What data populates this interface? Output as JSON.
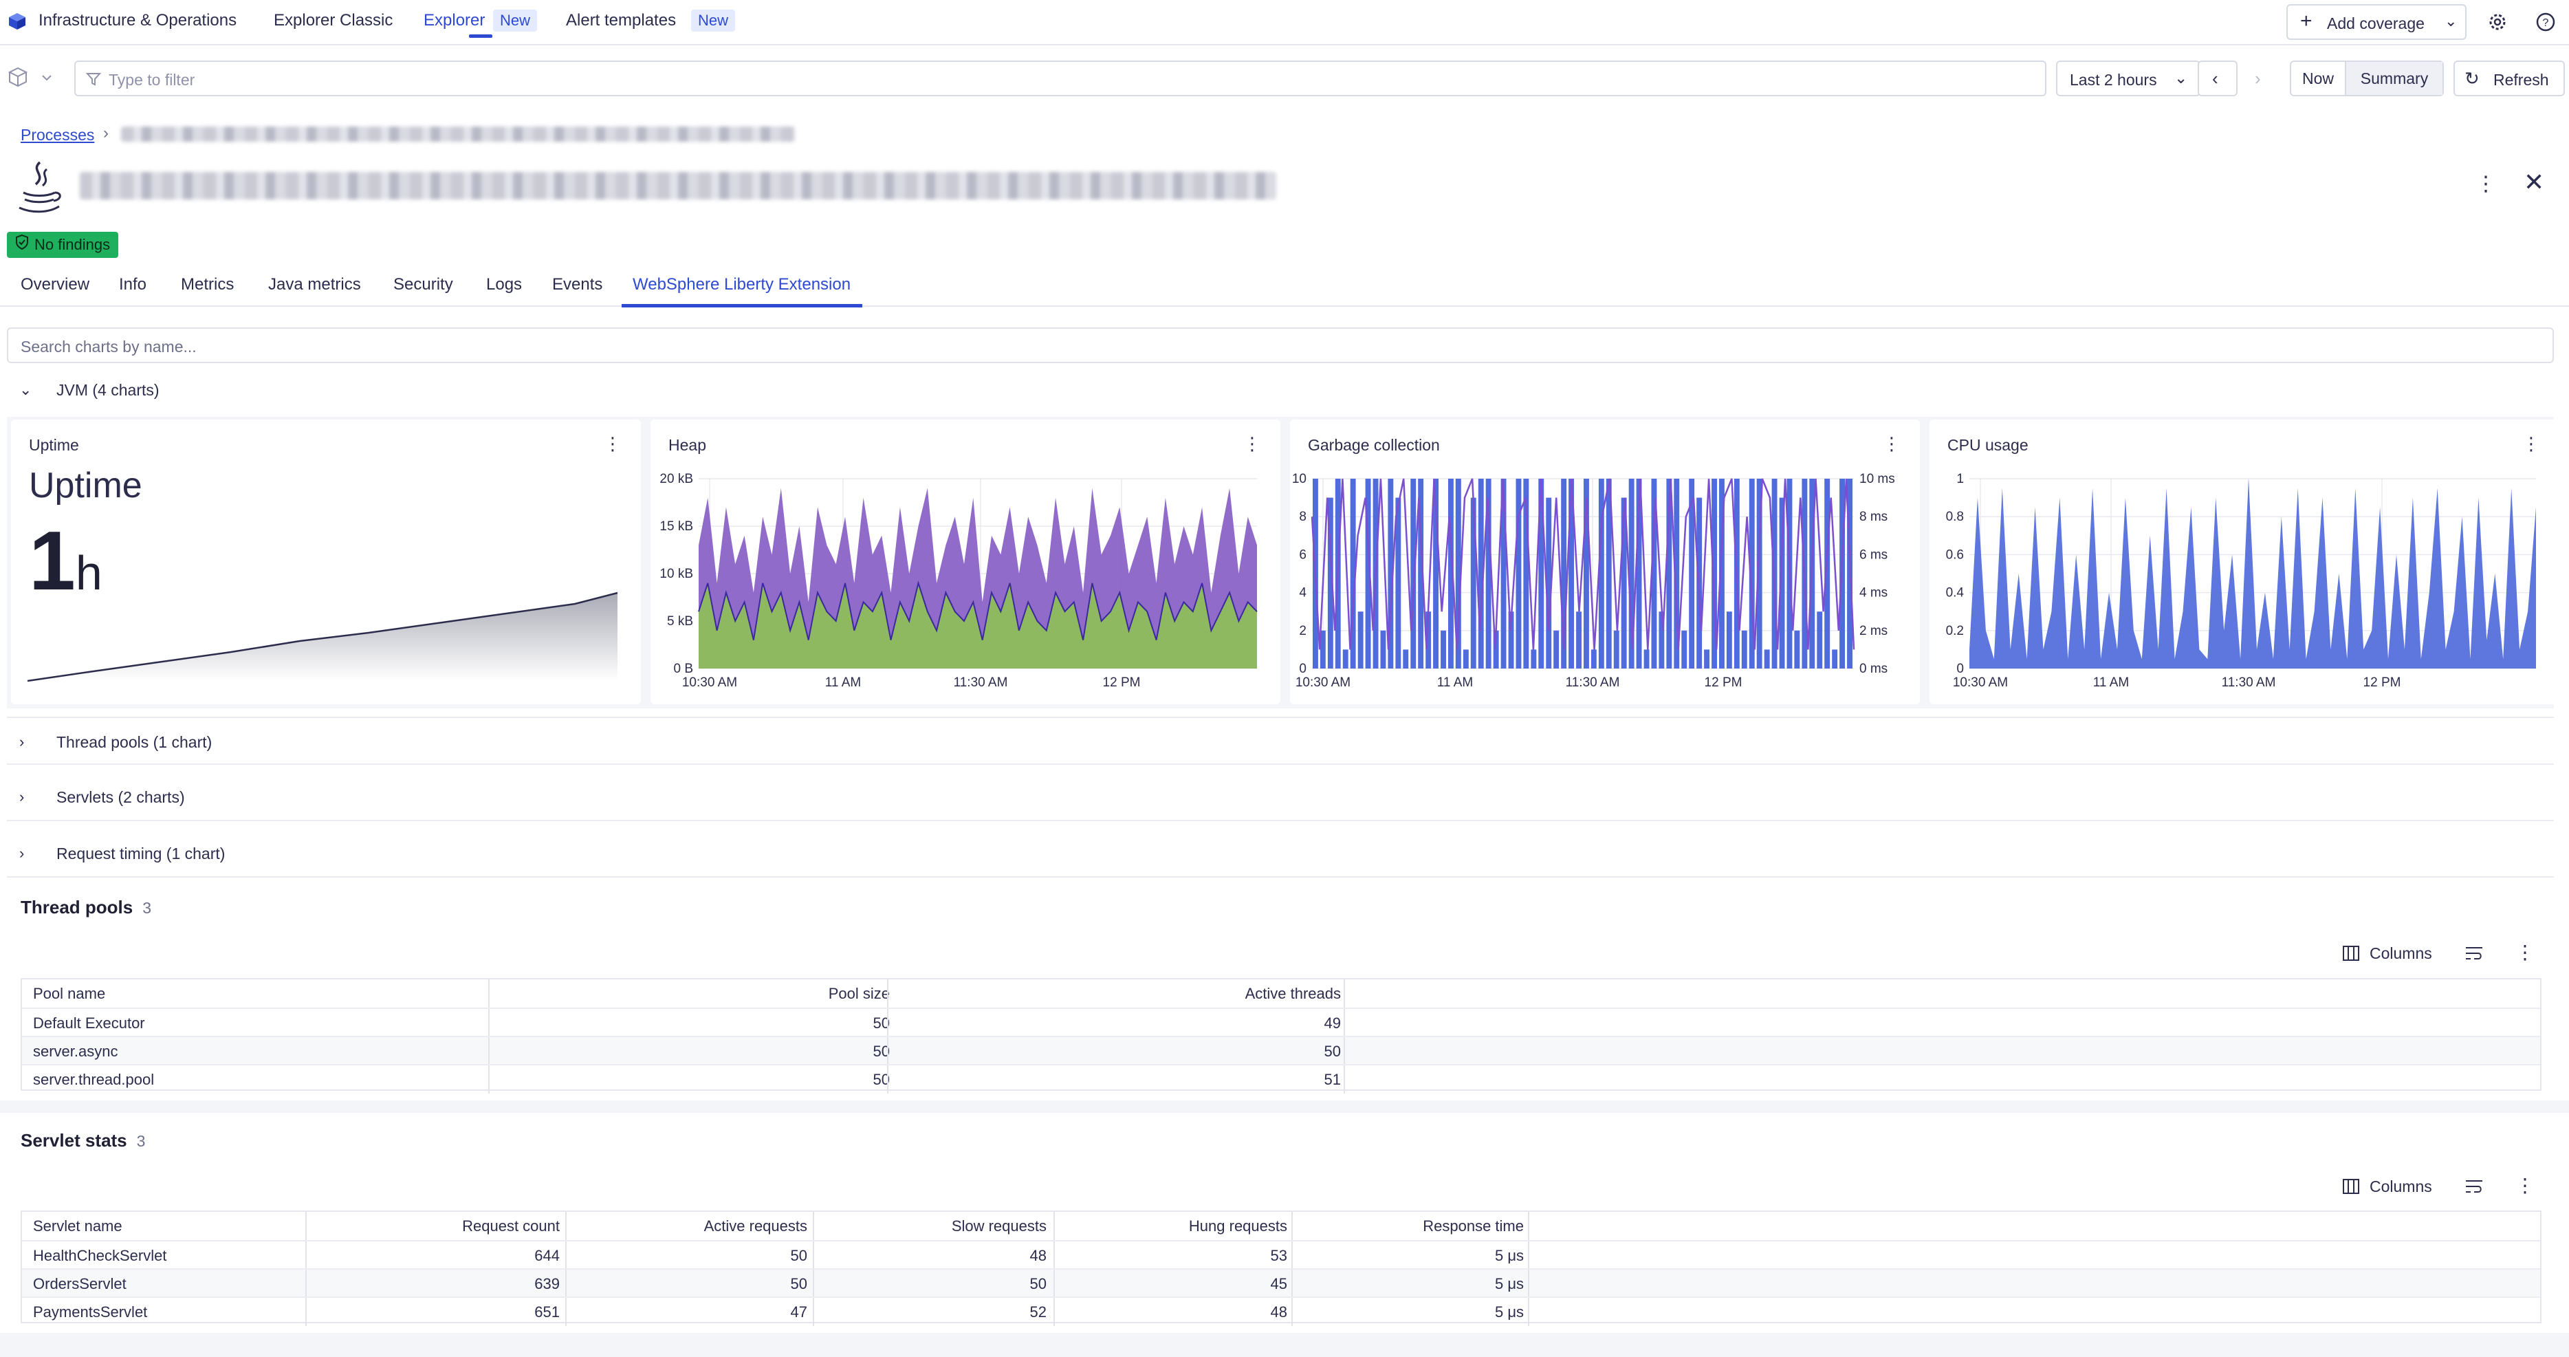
{
  "topbar": {
    "app_name": "Infrastructure & Operations",
    "tabs": [
      {
        "label": "Explorer Classic"
      },
      {
        "label": "Explorer",
        "badge": "New"
      },
      {
        "label": "Alert templates",
        "badge": "New"
      }
    ],
    "add_coverage": "Add coverage"
  },
  "filter": {
    "placeholder": "Type to filter",
    "timeframe": "Last 2 hours",
    "now": "Now",
    "summary": "Summary",
    "refresh": "Refresh"
  },
  "entity": {
    "breadcrumb": "Processes",
    "findings": "No findings",
    "tabs": [
      "Overview",
      "Info",
      "Metrics",
      "Java metrics",
      "Security",
      "Logs",
      "Events",
      "WebSphere Liberty Extension"
    ]
  },
  "charts": {
    "search_placeholder": "Search charts by name...",
    "sections": {
      "jvm": "JVM (4 charts)",
      "thread_pools": "Thread pools (1 chart)",
      "servlets": "Servlets (2 charts)",
      "request_timing": "Request timing (1 chart)"
    },
    "uptime": {
      "title": "Uptime",
      "label": "Uptime",
      "value": "1",
      "unit": "h"
    },
    "heap": {
      "title": "Heap"
    },
    "gc": {
      "title": "Garbage collection"
    },
    "cpu": {
      "title": "CPU usage"
    }
  },
  "chart_data": [
    {
      "type": "area",
      "title": "Heap",
      "x_ticks": [
        "10:30 AM",
        "11 AM",
        "11:30 AM",
        "12 PM"
      ],
      "y_ticks": [
        "0 B",
        "5 kB",
        "10 kB",
        "15 kB",
        "20 kB"
      ],
      "ylim": [
        0,
        20
      ],
      "colors": {
        "series1": "#8a63c7",
        "series2": "#8fbe5a",
        "line": "#3b2a9c"
      },
      "series": [
        {
          "values": [
            13,
            18,
            9,
            17,
            11,
            14,
            8,
            16,
            12,
            19,
            10,
            15,
            7,
            17,
            13,
            11,
            16,
            9,
            18,
            12,
            14,
            8,
            17,
            10,
            15,
            19,
            9,
            13,
            16,
            11,
            18,
            7,
            14,
            12,
            17,
            10,
            16,
            13,
            9,
            18,
            11,
            15,
            8,
            19,
            12,
            14,
            17,
            10,
            13,
            16,
            9,
            18,
            11,
            15,
            12,
            17,
            8,
            14,
            19,
            10,
            16,
            13
          ]
        },
        {
          "values": [
            6,
            9,
            4,
            8,
            5,
            7,
            3,
            9,
            6,
            8,
            4,
            7,
            3,
            8,
            6,
            5,
            9,
            4,
            7,
            6,
            8,
            3,
            7,
            5,
            9,
            6,
            4,
            8,
            6,
            5,
            7,
            3,
            8,
            6,
            9,
            4,
            7,
            5,
            4,
            8,
            6,
            7,
            3,
            9,
            5,
            6,
            8,
            4,
            7,
            6,
            3,
            8,
            5,
            7,
            6,
            9,
            4,
            6,
            8,
            5,
            7,
            6
          ]
        }
      ]
    },
    {
      "type": "bar",
      "title": "Garbage collection",
      "x_ticks": [
        "10:30 AM",
        "11 AM",
        "11:30 AM",
        "12 PM"
      ],
      "y_ticks": [
        "0",
        "2",
        "4",
        "6",
        "8",
        "10"
      ],
      "y2_ticks": [
        "0 ms",
        "2 ms",
        "4 ms",
        "6 ms",
        "8 ms",
        "10 ms"
      ],
      "ylim": [
        0,
        10
      ],
      "colors": {
        "bars": "#4f6bdc",
        "line": "#7a4fd0"
      },
      "values": [
        10,
        2,
        9,
        10,
        1,
        10,
        3,
        10,
        10,
        2,
        10,
        9,
        1,
        10,
        10,
        3,
        10,
        2,
        10,
        10,
        1,
        9,
        10,
        10,
        2,
        10,
        3,
        10,
        10,
        1,
        10,
        9,
        2,
        10,
        10,
        3,
        10,
        1,
        10,
        10,
        2,
        9,
        10,
        10,
        1,
        10,
        3,
        10,
        10,
        2,
        10,
        9,
        1,
        10,
        10,
        3,
        10,
        2,
        10,
        10,
        1,
        10,
        9,
        10,
        2,
        10,
        10,
        3,
        10,
        1,
        10,
        10
      ],
      "line": [
        8,
        1,
        9,
        2,
        10,
        1,
        7,
        9,
        2,
        10,
        1,
        8,
        10,
        2,
        9,
        1,
        10,
        3,
        8,
        1,
        9,
        10,
        2,
        9,
        1,
        10,
        2,
        8,
        9,
        1,
        10,
        2,
        9,
        1,
        10,
        3,
        9,
        1,
        8,
        10,
        2,
        9,
        1,
        10,
        1,
        9,
        2,
        10,
        1,
        8,
        9,
        2,
        10,
        1,
        9,
        10,
        2,
        8,
        1,
        10,
        9,
        1,
        10,
        2,
        9,
        1,
        10,
        3,
        9,
        2,
        10,
        1
      ]
    },
    {
      "type": "area",
      "title": "CPU usage",
      "x_ticks": [
        "10:30 AM",
        "11 AM",
        "11:30 AM",
        "12 PM"
      ],
      "y_ticks": [
        "0",
        "0.2",
        "0.4",
        "0.6",
        "0.8",
        "1"
      ],
      "ylim": [
        0,
        1
      ],
      "colors": {
        "fill": "#5470dc"
      },
      "values": [
        0.1,
        0.9,
        0.2,
        0.05,
        0.95,
        0.1,
        0.5,
        0.05,
        0.85,
        0.1,
        0.3,
        0.9,
        0.05,
        0.6,
        0.1,
        0.95,
        0.05,
        0.4,
        0.1,
        0.9,
        0.2,
        0.05,
        0.7,
        0.1,
        0.95,
        0.05,
        0.3,
        0.85,
        0.1,
        0.05,
        0.9,
        0.2,
        0.6,
        0.05,
        1.0,
        0.1,
        0.4,
        0.05,
        0.8,
        0.1,
        0.95,
        0.05,
        0.3,
        0.9,
        0.1,
        0.5,
        0.05,
        0.95,
        0.1,
        0.2,
        0.85,
        0.05,
        0.6,
        0.1,
        0.9,
        0.05,
        0.4,
        0.95,
        0.1,
        0.3,
        0.8,
        0.05,
        0.9,
        0.15,
        0.5,
        0.05,
        0.95,
        0.1,
        0.3,
        0.85
      ]
    }
  ],
  "thread_pools": {
    "title": "Thread pools",
    "count": "3",
    "columns_btn": "Columns",
    "headers": [
      "Pool name",
      "Pool size",
      "Active threads"
    ],
    "rows": [
      [
        "Default Executor",
        "50",
        "49"
      ],
      [
        "server.async",
        "50",
        "50"
      ],
      [
        "server.thread.pool",
        "50",
        "51"
      ]
    ]
  },
  "servlet_stats": {
    "title": "Servlet stats",
    "count": "3",
    "columns_btn": "Columns",
    "headers": [
      "Servlet name",
      "Request count",
      "Active requests",
      "Slow requests",
      "Hung requests",
      "Response time"
    ],
    "rows": [
      [
        "HealthCheckServlet",
        "644",
        "50",
        "48",
        "53",
        "5 μs"
      ],
      [
        "OrdersServlet",
        "639",
        "50",
        "50",
        "45",
        "5 μs"
      ],
      [
        "PaymentsServlet",
        "651",
        "47",
        "52",
        "48",
        "5 μs"
      ]
    ]
  }
}
